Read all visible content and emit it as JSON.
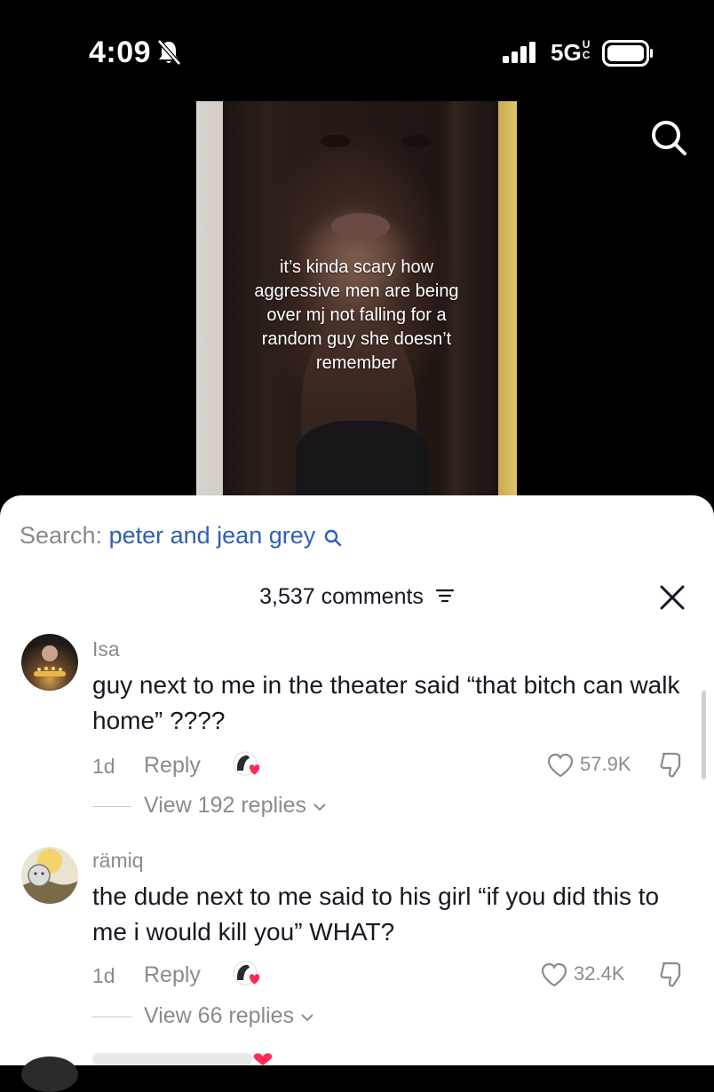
{
  "status_bar": {
    "time": "4:09",
    "network": "5G",
    "icons": [
      "bell-slash-icon",
      "signal-icon",
      "battery-icon"
    ]
  },
  "video": {
    "caption_lines": [
      "it’s kinda scary how",
      "aggressive men are being",
      "over mj not falling for a",
      "random guy she doesn’t",
      "remember"
    ]
  },
  "comments_sheet": {
    "search_label": "Search:",
    "search_query": "peter and jean grey",
    "comment_count": "3,537 comments",
    "comments": [
      {
        "username": "Isa",
        "text": "guy next to me in the theater said “that bitch can walk home” ????",
        "age": "1d",
        "reply_label": "Reply",
        "likes": "57.9K",
        "view_replies": "View 192 replies"
      },
      {
        "username": "rämiq",
        "text": "the dude next to me said to his girl “if you did this to me i would kill you” WHAT?",
        "age": "1d",
        "reply_label": "Reply",
        "likes": "32.4K",
        "view_replies": "View 66 replies"
      }
    ]
  },
  "colors": {
    "accent_link": "#2d5fb7",
    "muted_text": "#8a8b91",
    "primary_text": "#161823",
    "heart_red": "#fe2c55"
  }
}
